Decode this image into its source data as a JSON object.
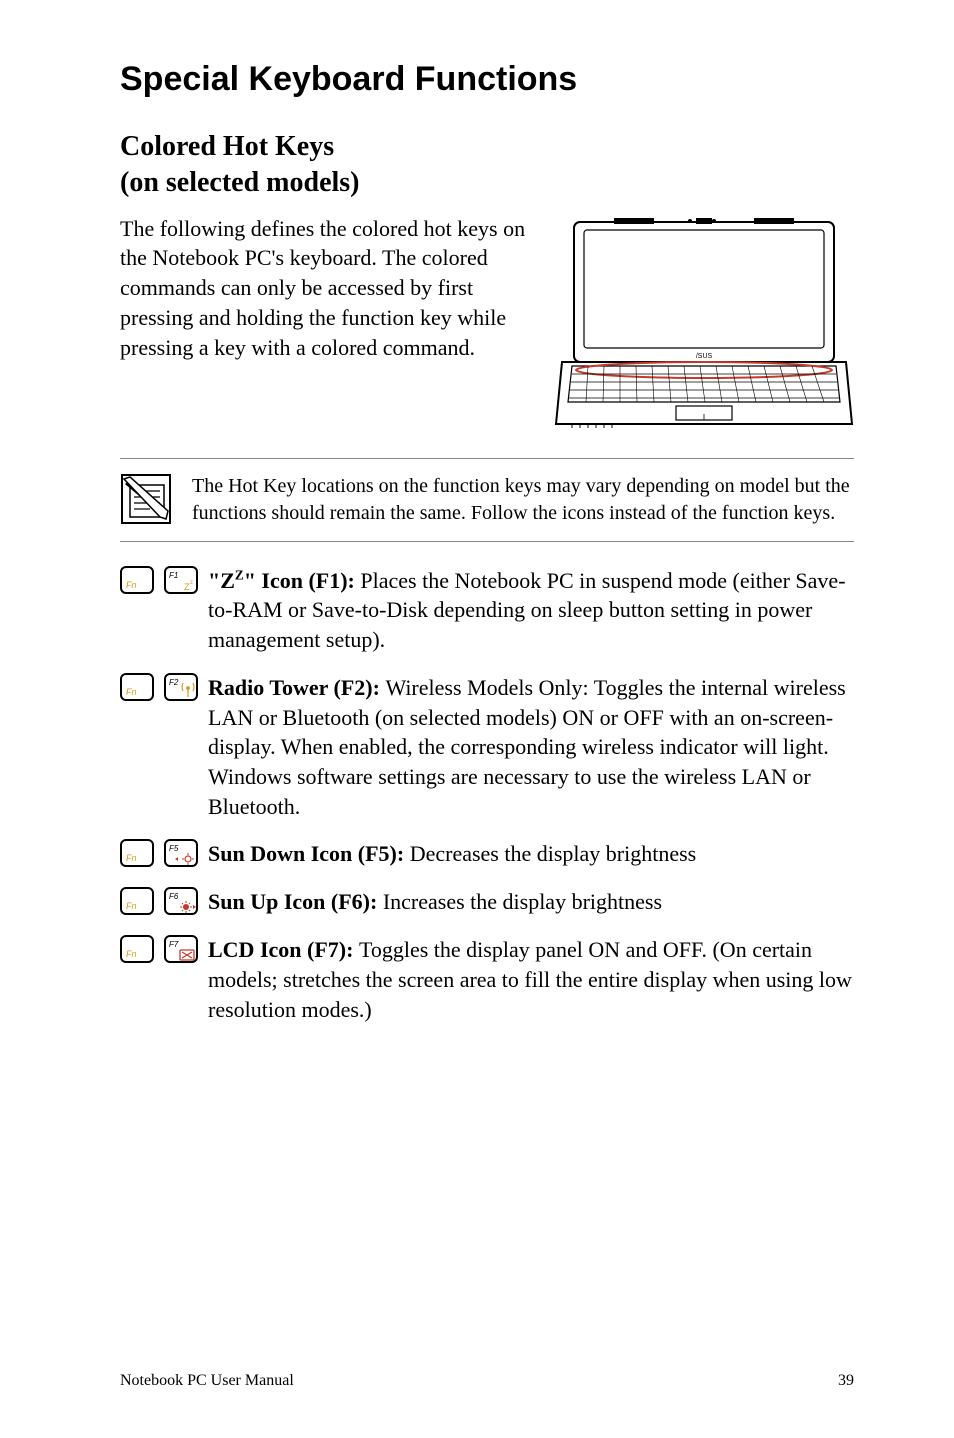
{
  "heading": "Special Keyboard Functions",
  "subheading_line1": "Colored Hot Keys",
  "subheading_line2": "(on selected models)",
  "intro": "The following defines the colored hot keys on the Notebook PC's keyboard. The colored commands can only be accessed by first pressing and holding the function key while pressing a key with a colored command.",
  "note": "The Hot Key locations on the function keys may vary depending on model but the functions should remain the same. Follow the icons instead of the function keys.",
  "items": {
    "f1": {
      "label_a": "\"Z",
      "label_sup": "Z",
      "label_b": "\" Icon (F1): ",
      "text": "Places the Notebook PC in suspend mode (either Save-to-RAM or Save-to-Disk depending on sleep button setting in power management setup)."
    },
    "f2": {
      "label": "Radio Tower (F2): ",
      "text": "Wireless Models Only: Toggles the internal wireless LAN or Bluetooth (on selected models) ON or OFF with an on-screen-display. When enabled, the corresponding wireless indicator will light. Windows software settings are necessary to use the wireless LAN or Bluetooth."
    },
    "f5": {
      "label": "Sun Down Icon (F5): ",
      "text": "Decreases the display brightness"
    },
    "f6": {
      "label": "Sun Up Icon (F6): ",
      "text": "Increases the display brightness"
    },
    "f7": {
      "label": "LCD Icon (F7): ",
      "text": "Toggles the display panel ON and OFF. (On certain models; stretches the screen area to fill the entire display when using low resolution modes.)"
    }
  },
  "footer_left": "Notebook PC User Manual",
  "footer_right": "39",
  "colors": {
    "fn_text": "#d9991f",
    "keycap_orange": "#d9991f",
    "keycap_red": "#c63a2e"
  }
}
